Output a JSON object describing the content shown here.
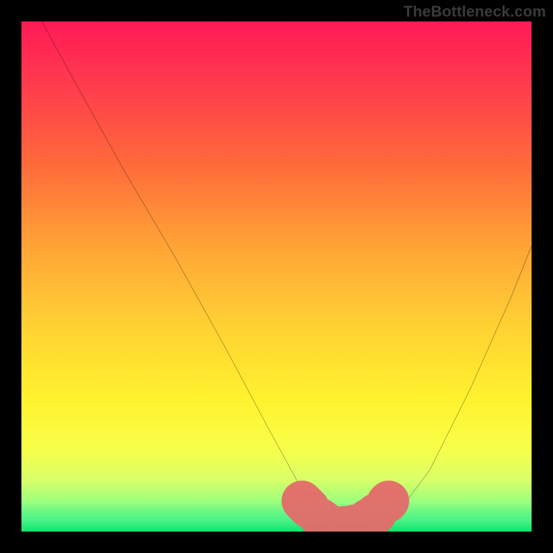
{
  "watermark": "TheBottleneck.com",
  "chart_data": {
    "type": "line",
    "title": "",
    "xlabel": "",
    "ylabel": "",
    "xlim": [
      0,
      100
    ],
    "ylim": [
      0,
      100
    ],
    "grid": false,
    "legend": false,
    "series": [
      {
        "name": "bottleneck-curve",
        "color": "#000000",
        "x": [
          4,
          10,
          20,
          30,
          40,
          48,
          54,
          58,
          62,
          66,
          70,
          74,
          80,
          88,
          96,
          100
        ],
        "y": [
          100,
          89,
          71,
          54,
          36,
          21,
          10,
          4,
          1,
          1,
          2,
          4,
          12,
          28,
          46,
          56
        ]
      },
      {
        "name": "optimal-flat-highlight",
        "color": "#e46a6a",
        "x": [
          55,
          58,
          60,
          62,
          64,
          66,
          69,
          72
        ],
        "y": [
          6,
          3,
          1.5,
          1,
          1,
          1.5,
          3,
          6
        ]
      }
    ],
    "annotations": [],
    "background_gradient": {
      "top": "#ff1a55",
      "mid": "#fff22e",
      "bottom": "#0be56f"
    }
  }
}
